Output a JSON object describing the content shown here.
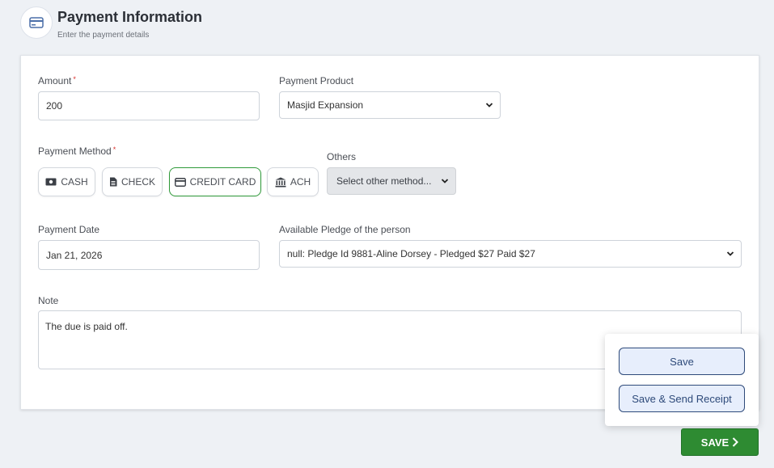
{
  "header": {
    "title": "Payment Information",
    "subtitle": "Enter the payment details"
  },
  "form": {
    "amount": {
      "label": "Amount",
      "required": "*",
      "value": "200"
    },
    "product": {
      "label": "Payment Product",
      "value": "Masjid Expansion"
    },
    "method": {
      "label": "Payment Method",
      "required": "*",
      "options": [
        {
          "label": "CASH",
          "icon": "cash-icon"
        },
        {
          "label": "CHECK",
          "icon": "check-document-icon"
        },
        {
          "label": "CREDIT CARD",
          "icon": "credit-card-icon",
          "active": true
        },
        {
          "label": "ACH",
          "icon": "bank-icon"
        }
      ]
    },
    "others": {
      "label": "Others",
      "value": "Select other method..."
    },
    "date": {
      "label": "Payment Date",
      "value": "Jan 21, 2026"
    },
    "pledge": {
      "label": "Available Pledge of the person",
      "value": "null: Pledge Id 9881-Aline Dorsey - Pledged $27 Paid $27"
    },
    "note": {
      "label": "Note",
      "value": "The due is paid off."
    }
  },
  "popup": {
    "save_label": "Save",
    "save_send_label": "Save & Send Receipt"
  },
  "footer": {
    "save_label": "SAVE"
  },
  "colors": {
    "accent_green": "#2e8b32",
    "active_border": "#2f9a3a",
    "popup_blue": "#2e4a7a",
    "required_red": "#d9302c"
  }
}
